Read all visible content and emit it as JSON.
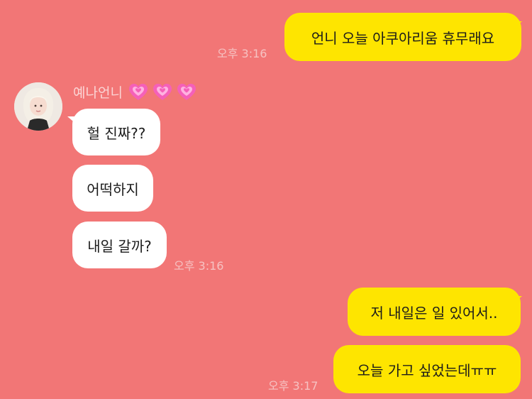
{
  "chat": {
    "messages": [
      {
        "text": "언니 오늘 아쿠아리움 휴무래요",
        "time": "오후 3:16"
      },
      {
        "text": "헐 진짜??"
      },
      {
        "text": "어떡하지"
      },
      {
        "text": "내일 갈까?",
        "time": "오후 3:16"
      },
      {
        "text": "저 내일은 일 있어서.."
      },
      {
        "text": "오늘 가고 싶었는데ㅠㅠ",
        "time": "오후 3:17"
      }
    ]
  },
  "sender": {
    "name": "예나언니",
    "hearts_icon": "sparkling-heart-icon"
  },
  "colors": {
    "background": "#f27676",
    "outgoing_bubble": "#fee500",
    "incoming_bubble": "#ffffff"
  }
}
